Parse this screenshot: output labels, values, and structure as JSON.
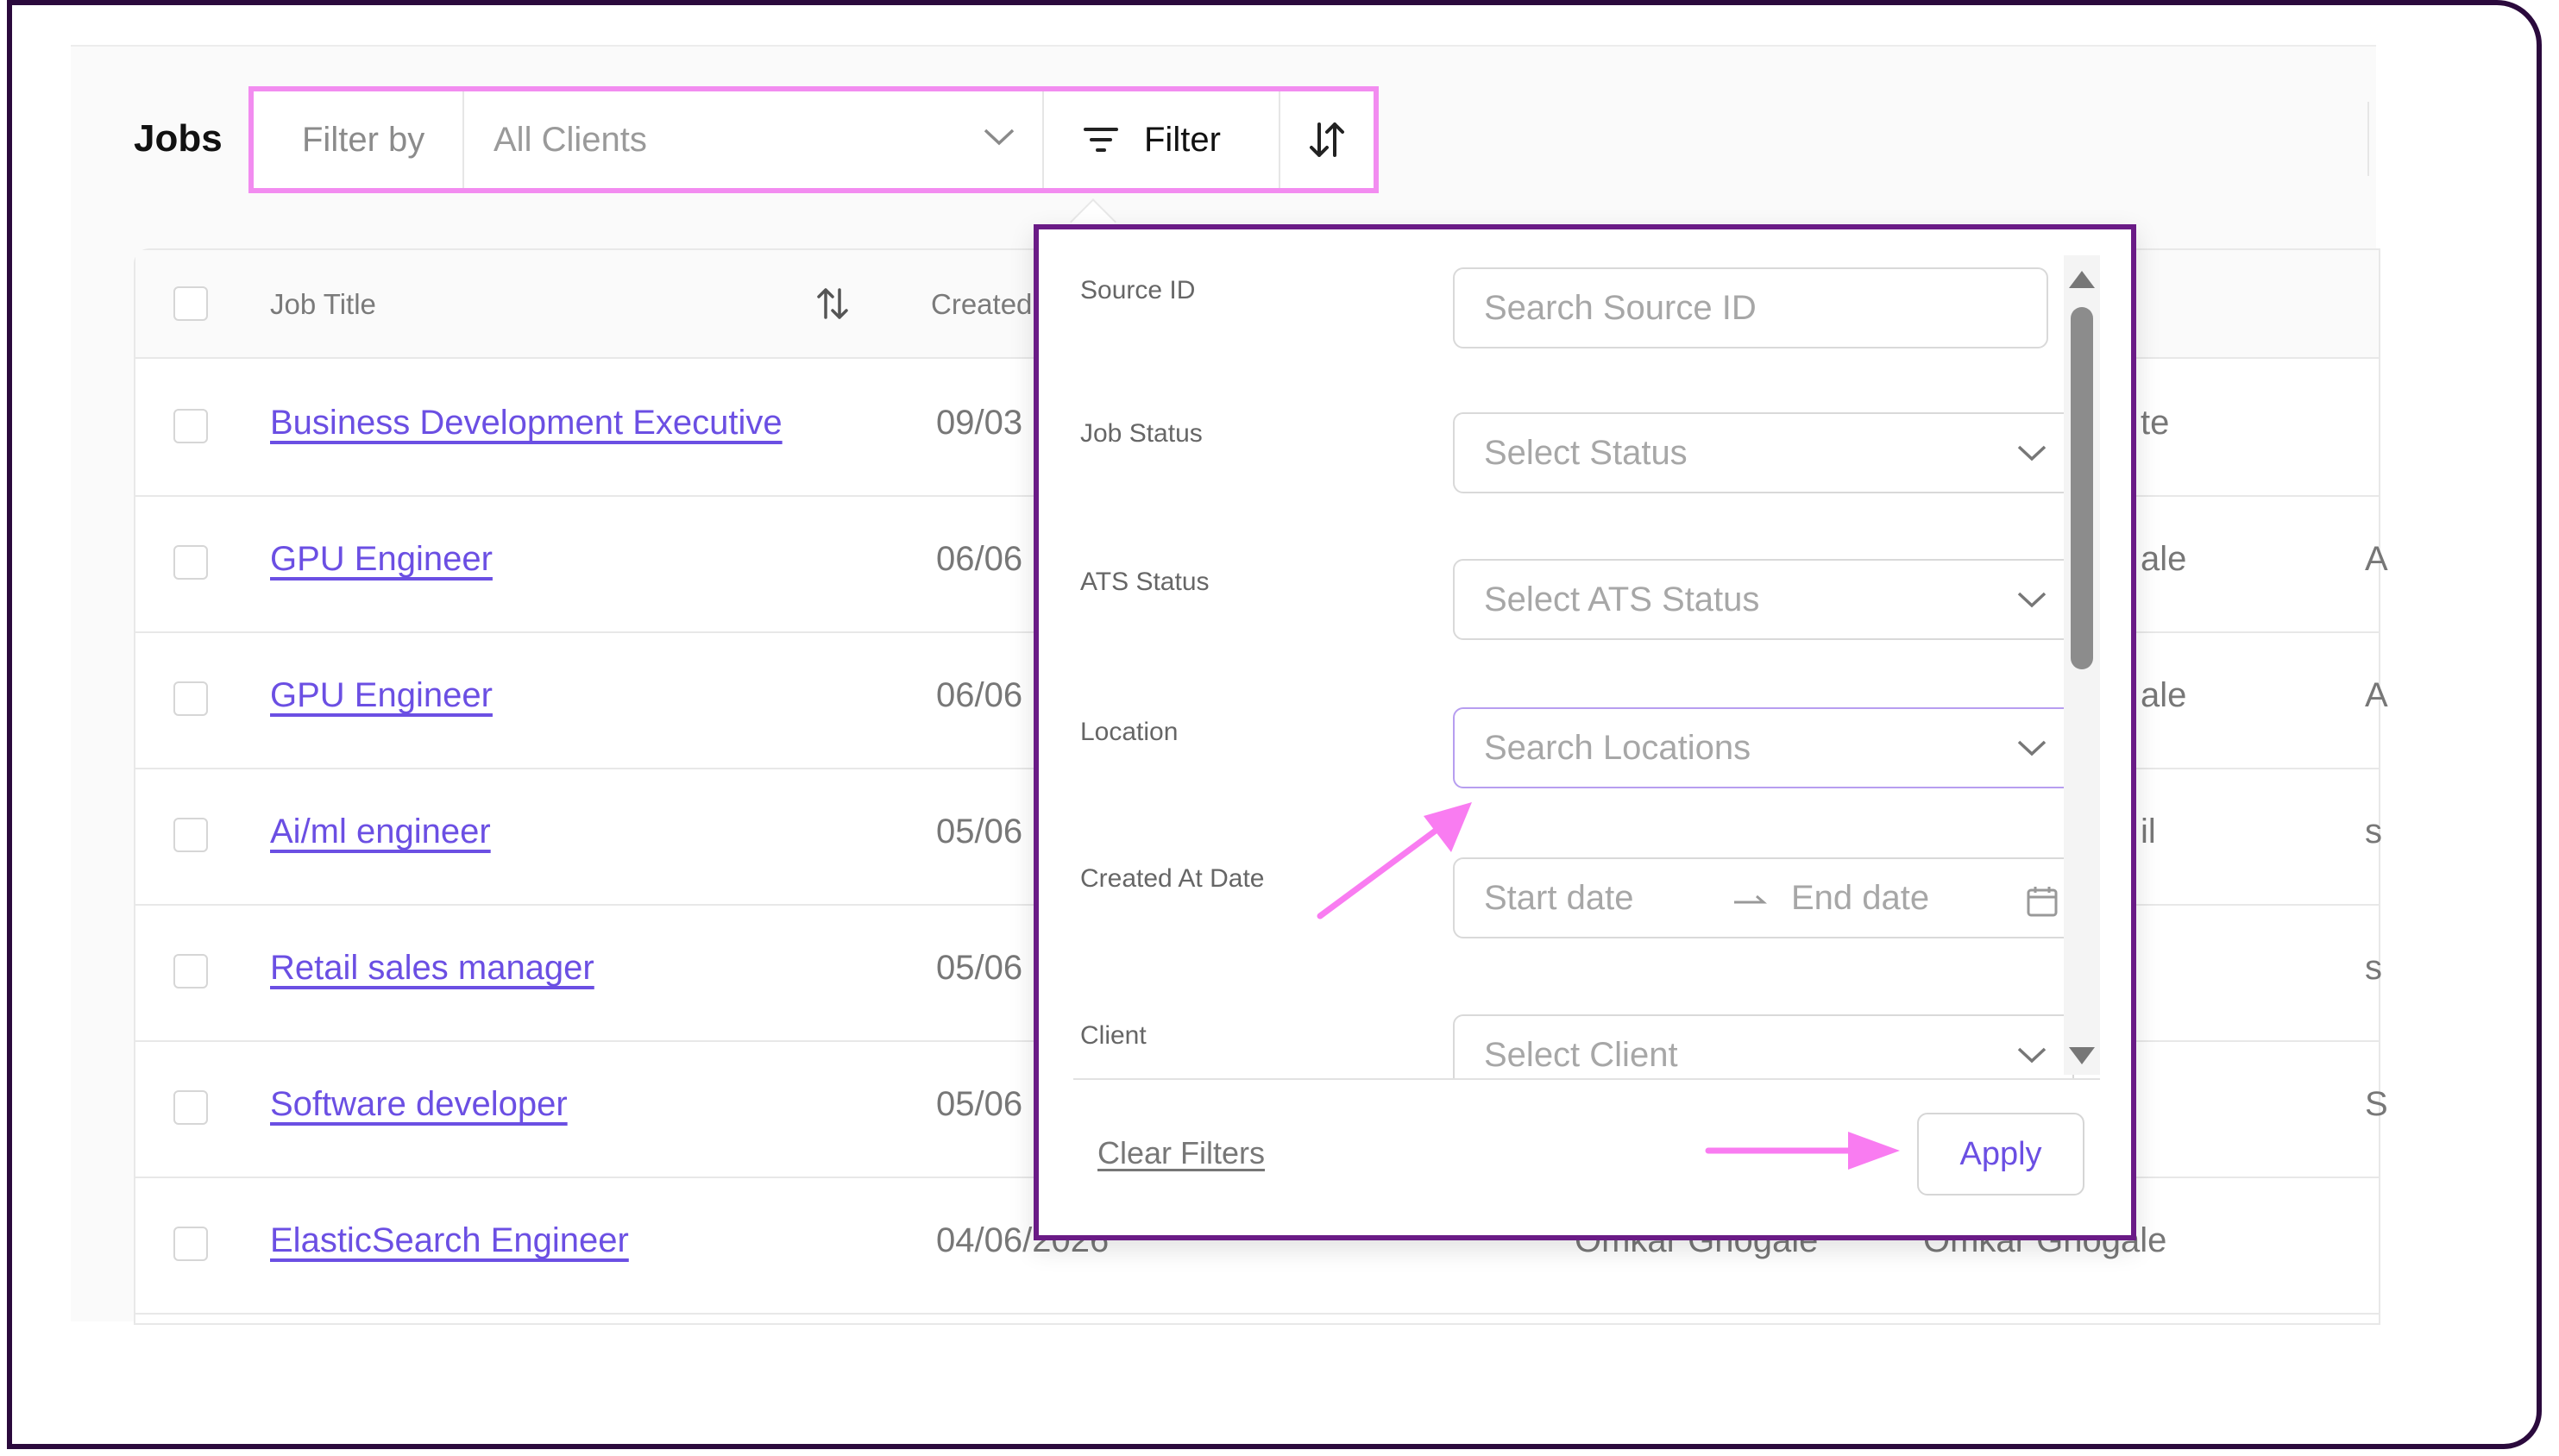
{
  "page": {
    "heading": "Jobs"
  },
  "filter_bar": {
    "label": "Filter by",
    "client_select": "All Clients",
    "filter_button": "Filter"
  },
  "table": {
    "headers": {
      "job_title": "Job Title",
      "created": "Created"
    },
    "rows": [
      {
        "title": "Business Development Executive",
        "date": "09/03",
        "frag1": "te",
        "frag2": ""
      },
      {
        "title": "GPU Engineer",
        "date": "06/06",
        "frag1": "ale",
        "frag2": "A"
      },
      {
        "title": "GPU Engineer",
        "date": "06/06",
        "frag1": "ale",
        "frag2": "A"
      },
      {
        "title": "Ai/ml engineer",
        "date": "05/06",
        "frag1": "il",
        "frag2": "s"
      },
      {
        "title": "Retail sales manager",
        "date": "05/06",
        "frag1": "",
        "frag2": "s"
      },
      {
        "title": "Software developer",
        "date": "05/06",
        "frag1": "",
        "frag2": "S"
      },
      {
        "title": "ElasticSearch Engineer",
        "date": "04/06/2026",
        "created_by": "Omkar Ghogale",
        "owner": "Omkar Ghogale"
      }
    ]
  },
  "filter_panel": {
    "fields": [
      {
        "label": "Source ID",
        "placeholder": "Search Source ID"
      },
      {
        "label": "Job Status",
        "placeholder": "Select Status"
      },
      {
        "label": "ATS Status",
        "placeholder": "Select ATS Status"
      },
      {
        "label": "Location",
        "placeholder": "Search Locations"
      },
      {
        "label": "Created At Date",
        "start": "Start date",
        "end": "End date"
      },
      {
        "label": "Client",
        "placeholder": "Select Client"
      }
    ],
    "clear_label": "Clear Filters",
    "apply_label": "Apply"
  },
  "colors": {
    "accent": "#6b4fe3",
    "highlight": "#f28cf0",
    "panel_border": "#6a1b86"
  }
}
